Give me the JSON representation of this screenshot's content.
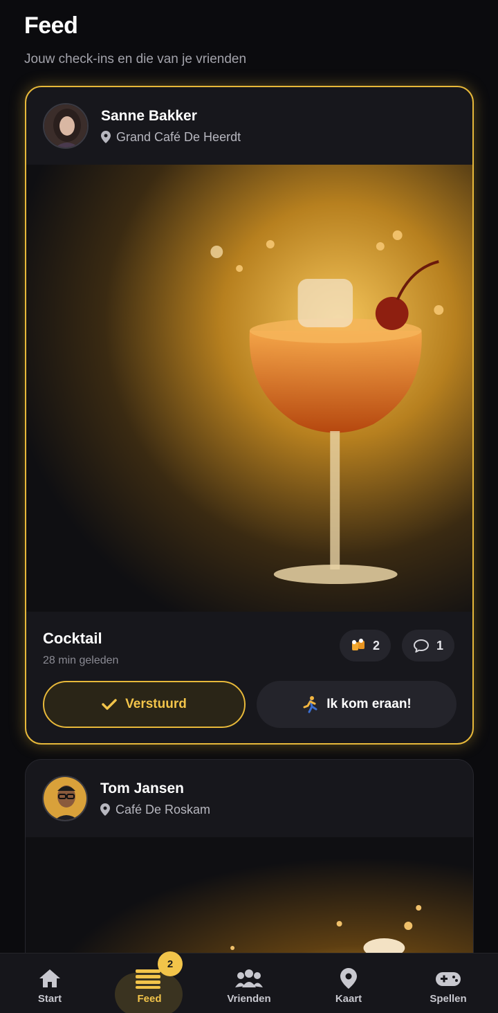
{
  "header": {
    "title": "Feed",
    "subtitle": "Jouw check-ins en die van je vrienden"
  },
  "posts": [
    {
      "user": "Sanne Bakker",
      "venue": "Grand Café De Heerdt",
      "drink": "Cocktail",
      "time_ago": "28 min geleden",
      "cheers_count": "2",
      "comment_count": "1",
      "sent_label": "Verstuurd",
      "coming_label": "Ik kom eraan!"
    },
    {
      "user": "Tom Jansen",
      "venue": "Café De Roskam"
    }
  ],
  "tabbar": {
    "items": [
      {
        "label": "Start",
        "icon": "home-icon"
      },
      {
        "label": "Feed",
        "icon": "feed-list-icon",
        "badge": "2"
      },
      {
        "label": "Vrienden",
        "icon": "friends-icon"
      },
      {
        "label": "Kaart",
        "icon": "map-pin-icon"
      },
      {
        "label": "Spellen",
        "icon": "gamepad-icon"
      }
    ]
  },
  "colors": {
    "accent": "#e8b93a",
    "background": "#0b0b0e",
    "card": "#17171c"
  }
}
